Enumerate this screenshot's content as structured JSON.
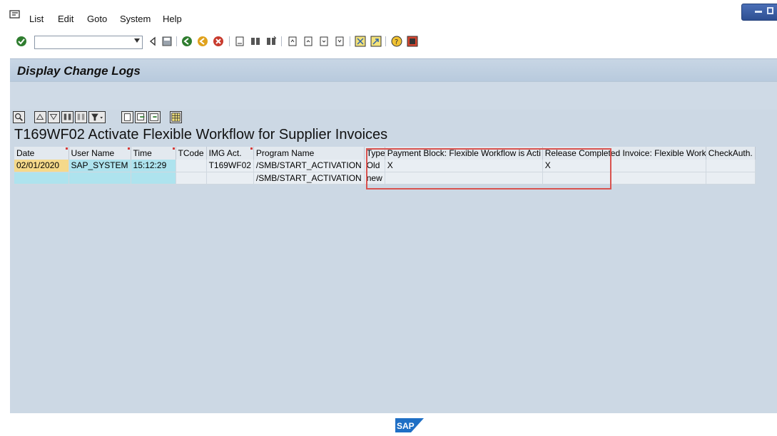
{
  "menu": {
    "items": [
      {
        "label": "List"
      },
      {
        "label": "Edit"
      },
      {
        "label": "Goto"
      },
      {
        "label": "System"
      },
      {
        "label": "Help"
      }
    ]
  },
  "toolbar": {
    "command_field_value": "",
    "icons": [
      "enter-icon",
      "back-icon",
      "save-icon",
      "back-green-icon",
      "exit-icon",
      "cancel-icon",
      "print-icon",
      "find-icon",
      "find-next-icon",
      "first-page-icon",
      "prev-page-icon",
      "next-page-icon",
      "last-page-icon",
      "create-session-icon",
      "shortcut-icon",
      "help-icon",
      "layout-icon"
    ]
  },
  "page": {
    "title": "Display Change Logs"
  },
  "alv_toolbar": {
    "icons": [
      "details-icon",
      "sort-ascending-icon",
      "sort-descending-icon",
      "find-icon",
      "find-next-icon",
      "filter-icon",
      "print-preview-icon",
      "export-icon",
      "spreadsheet-icon",
      "layout-icon"
    ]
  },
  "list": {
    "title": "T169WF02 Activate Flexible Workflow for Supplier Invoices",
    "columns": [
      "Date",
      "User Name",
      "Time",
      "TCode",
      "IMG Act.",
      "Program Name",
      "Type",
      "Payment Block: Flexible Workflow is Acti",
      "Release Completed Invoice: Flexible Work",
      "CheckAuth."
    ],
    "rows": [
      [
        "02/01/2020",
        "SAP_SYSTEM",
        "15:12:29",
        "",
        "T169WF02",
        "/SMB/START_ACTIVATION",
        "Old",
        "X",
        "X",
        ""
      ],
      [
        "",
        "",
        "",
        "",
        "",
        "/SMB/START_ACTIVATION",
        "new",
        "",
        "",
        ""
      ]
    ]
  },
  "footer": {
    "logo": "SAP"
  },
  "colors": {
    "highlight_box": "#d9534f",
    "key_date": "#f5d98a",
    "key_cyan": "#aee3ee"
  }
}
